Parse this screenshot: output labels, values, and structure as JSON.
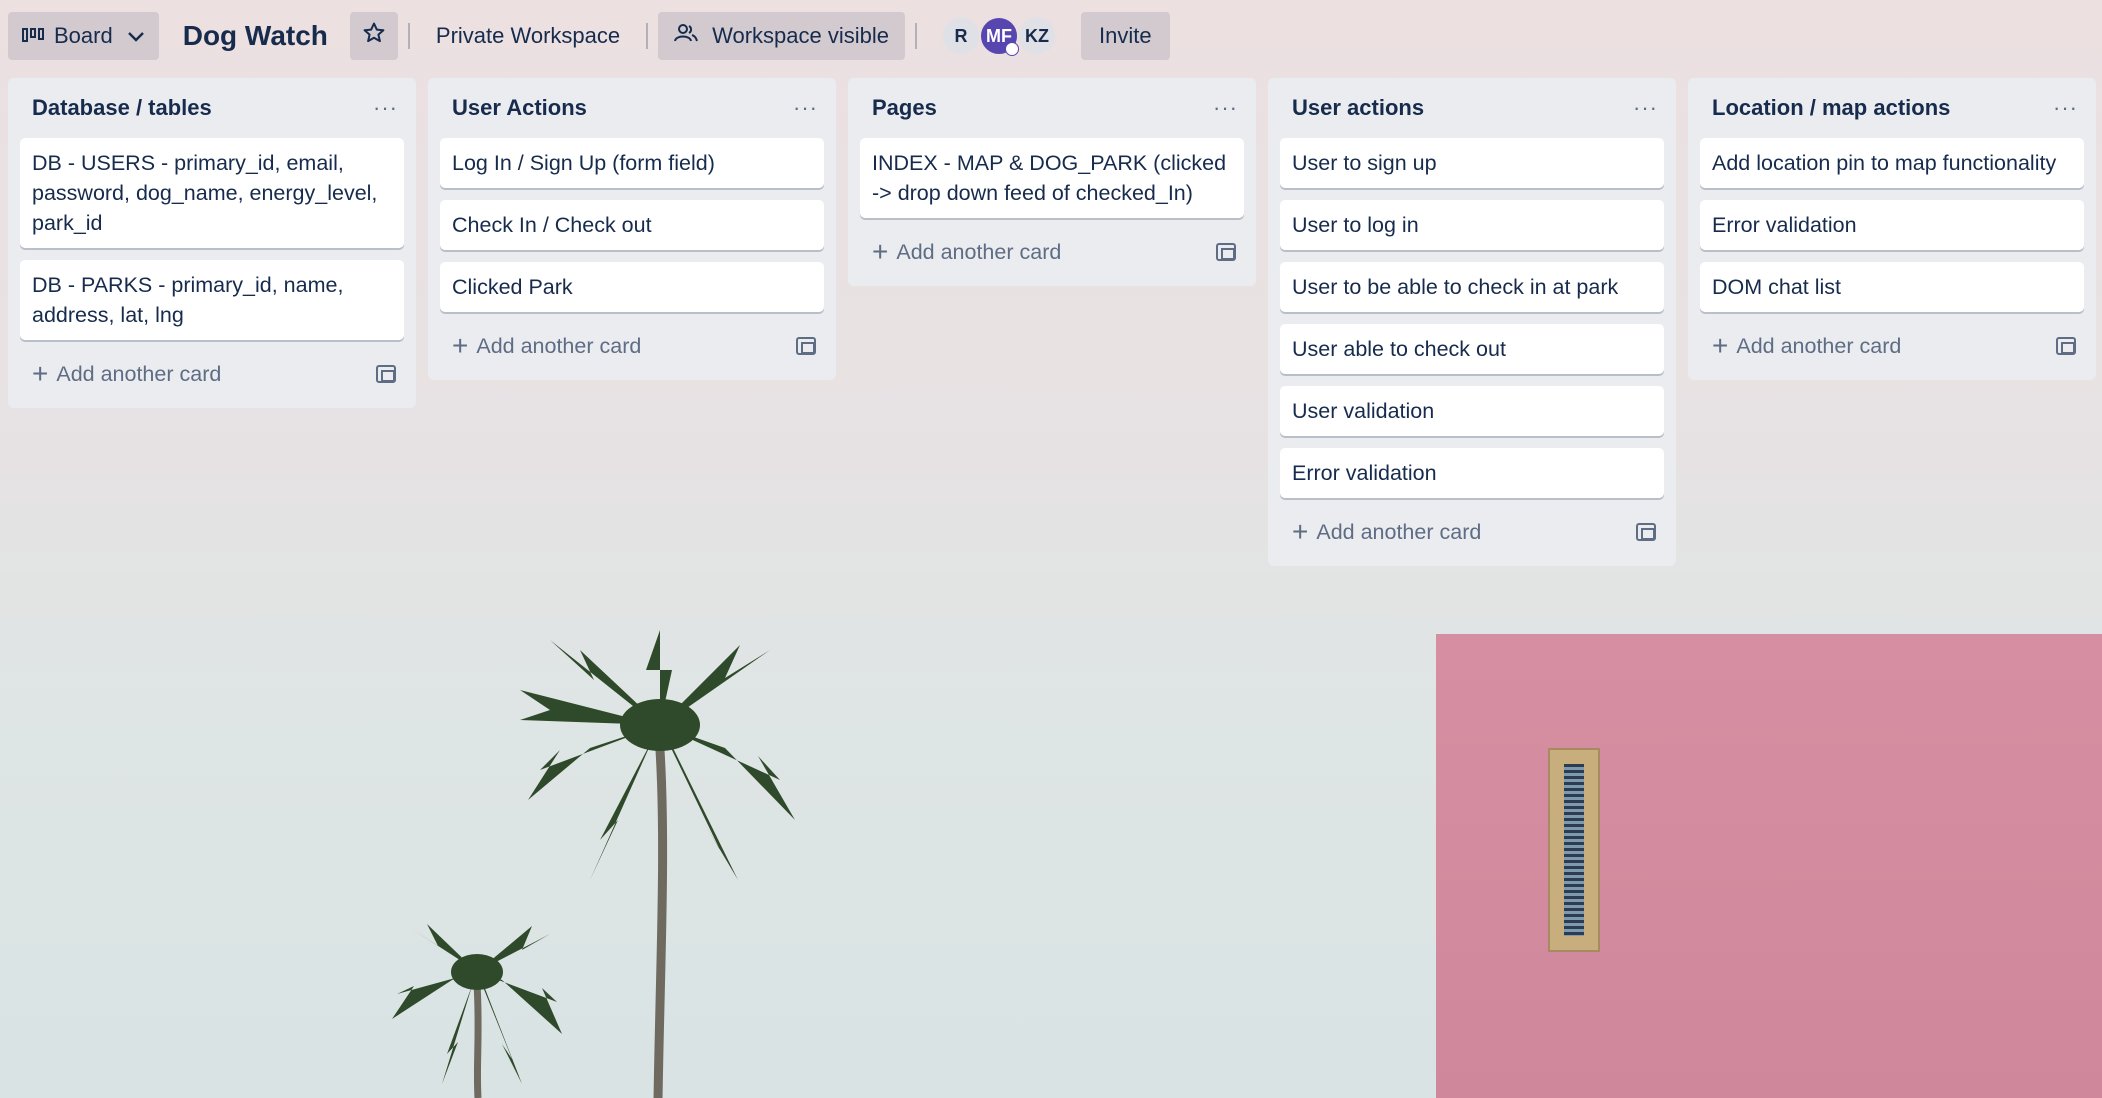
{
  "header": {
    "view_label": "Board",
    "board_title": "Dog Watch",
    "workspace_label": "Private Workspace",
    "visibility_label": "Workspace visible",
    "members": [
      "R",
      "MF",
      "KZ"
    ],
    "invite_label": "Invite"
  },
  "lists": [
    {
      "title": "Database / tables",
      "menu": "···",
      "cards": [
        "DB - USERS - primary_id, email, password, dog_name, energy_level, park_id",
        "DB - PARKS - primary_id, name, address, lat, lng"
      ],
      "add_label": "Add another card"
    },
    {
      "title": "User Actions",
      "menu": "···",
      "cards": [
        "Log In / Sign Up (form field)",
        "Check In / Check out",
        "Clicked Park"
      ],
      "add_label": "Add another card"
    },
    {
      "title": "Pages",
      "menu": "···",
      "cards": [
        "INDEX - MAP & DOG_PARK (clicked -> drop down feed of checked_In)"
      ],
      "add_label": "Add another card"
    },
    {
      "title": "User actions",
      "menu": "···",
      "cards": [
        "User to sign up",
        "User to log in",
        "User to be able to check in at park",
        "User able to check out",
        "User validation",
        "Error validation"
      ],
      "add_label": "Add another card"
    },
    {
      "title": "Location / map actions",
      "menu": "···",
      "cards": [
        "Add location pin to map functionality",
        "Error validation",
        "DOM chat list"
      ],
      "add_label": "Add another card"
    }
  ],
  "icons": {
    "view": "board-icon",
    "star": "star-icon",
    "visibility": "people-icon",
    "add": "plus-icon",
    "template": "card-template-icon"
  },
  "colors": {
    "list_bg": "#ebecf0",
    "text": "#172b4d",
    "avatar_mf": "#5746af",
    "wall": "#d68fa2"
  }
}
